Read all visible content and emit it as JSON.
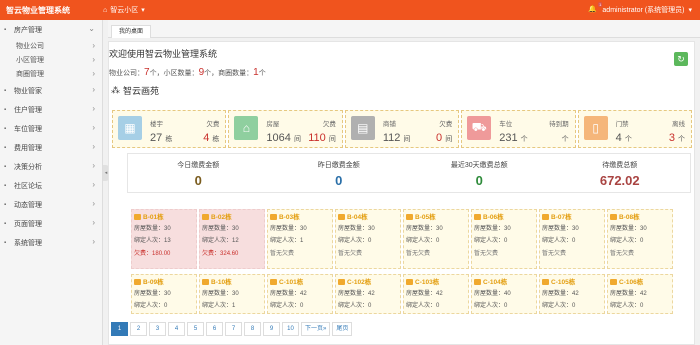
{
  "app": {
    "title": "智云物业管理系统",
    "current_community": "智云小区",
    "user": "administrator (系统管理员)",
    "notify_count": "1"
  },
  "sidebar": {
    "items": [
      {
        "label": "房产管理",
        "expanded": true,
        "subs": [
          "物业公司",
          "小区管理",
          "商圈管理"
        ]
      },
      {
        "label": "物业管家"
      },
      {
        "label": "住户管理"
      },
      {
        "label": "车位管理"
      },
      {
        "label": "费用管理"
      },
      {
        "label": "决策分析"
      },
      {
        "label": "社区论坛"
      },
      {
        "label": "动态管理"
      },
      {
        "label": "页面管理"
      },
      {
        "label": "系统管理"
      }
    ]
  },
  "tabs": [
    "我的桌面"
  ],
  "welcome": "欢迎使用智云物业管理系统",
  "summary": {
    "prefix1": "物业公司：",
    "company_count": "7",
    "unit": "个",
    "prefix2": "，小区数量：",
    "community_count": "9",
    "prefix3": "，商圈数量：",
    "zone_count": "1"
  },
  "community_name": "智云画苑",
  "cards": [
    {
      "label": "楼宇",
      "label2": "欠费",
      "value": "27",
      "unit": "栋",
      "value2": "4",
      "unit2": "栋",
      "color": "#a6cfe6",
      "icon": "building-icon"
    },
    {
      "label": "房屋",
      "label2": "欠费",
      "value": "1064",
      "unit": "间",
      "value2": "110",
      "unit2": "间",
      "color": "#8fcf9f",
      "icon": "house-icon"
    },
    {
      "label": "商铺",
      "label2": "欠费",
      "value": "112",
      "unit": "间",
      "value2": "0",
      "unit2": "间",
      "color": "#b0b0b0",
      "icon": "shop-icon"
    },
    {
      "label": "车位",
      "label2": "待到期",
      "value": "231",
      "unit": "个",
      "value2": "",
      "unit2": "个",
      "color": "#ef9a9a",
      "icon": "car-icon"
    },
    {
      "label": "门禁",
      "label2": "离线",
      "value": "4",
      "unit": "个",
      "value2": "3",
      "unit2": "个",
      "color": "#f5b67a",
      "icon": "door-icon"
    }
  ],
  "fees": [
    {
      "title": "今日缴费金额",
      "value": "0",
      "color": "#7a5c1e"
    },
    {
      "title": "昨日缴费金额",
      "value": "0",
      "color": "#2a6fa8"
    },
    {
      "title": "最近30天缴费总额",
      "value": "0",
      "color": "#2e8b3a"
    },
    {
      "title": "待缴费总额",
      "value": "672.02",
      "color": "#a94442"
    }
  ],
  "labels": {
    "rooms": "房屋数量：",
    "bound": "绑定人次：",
    "arrears": "欠费：",
    "no_arrears": "暂无欠费"
  },
  "buildings": [
    {
      "name": "B-01栋",
      "rooms": "30",
      "bound": "13",
      "arrears": "180.00",
      "pink": true
    },
    {
      "name": "B-02栋",
      "rooms": "30",
      "bound": "12",
      "arrears": "324.60",
      "pink": true
    },
    {
      "name": "B-03栋",
      "rooms": "30",
      "bound": "1",
      "arrears": ""
    },
    {
      "name": "B-04栋",
      "rooms": "30",
      "bound": "0",
      "arrears": ""
    },
    {
      "name": "B-05栋",
      "rooms": "30",
      "bound": "0",
      "arrears": ""
    },
    {
      "name": "B-06栋",
      "rooms": "30",
      "bound": "0",
      "arrears": ""
    },
    {
      "name": "B-07栋",
      "rooms": "30",
      "bound": "0",
      "arrears": ""
    },
    {
      "name": "B-08栋",
      "rooms": "30",
      "bound": "0",
      "arrears": ""
    },
    {
      "name": "B-09栋",
      "rooms": "30",
      "bound": "0",
      "arrears": ""
    },
    {
      "name": "B-10栋",
      "rooms": "30",
      "bound": "1",
      "arrears": ""
    },
    {
      "name": "C-101栋",
      "rooms": "42",
      "bound": "0",
      "arrears": ""
    },
    {
      "name": "C-102栋",
      "rooms": "42",
      "bound": "0",
      "arrears": ""
    },
    {
      "name": "C-103栋",
      "rooms": "42",
      "bound": "0",
      "arrears": ""
    },
    {
      "name": "C-104栋",
      "rooms": "40",
      "bound": "0",
      "arrears": ""
    },
    {
      "name": "C-105栋",
      "rooms": "42",
      "bound": "0",
      "arrears": ""
    },
    {
      "name": "C-106栋",
      "rooms": "42",
      "bound": "0",
      "arrears": ""
    }
  ],
  "pager": {
    "pages": [
      "1",
      "2",
      "3",
      "4",
      "5",
      "6",
      "7",
      "8",
      "9",
      "10"
    ],
    "next": "下一页»",
    "last": "尾页",
    "current": "1"
  }
}
